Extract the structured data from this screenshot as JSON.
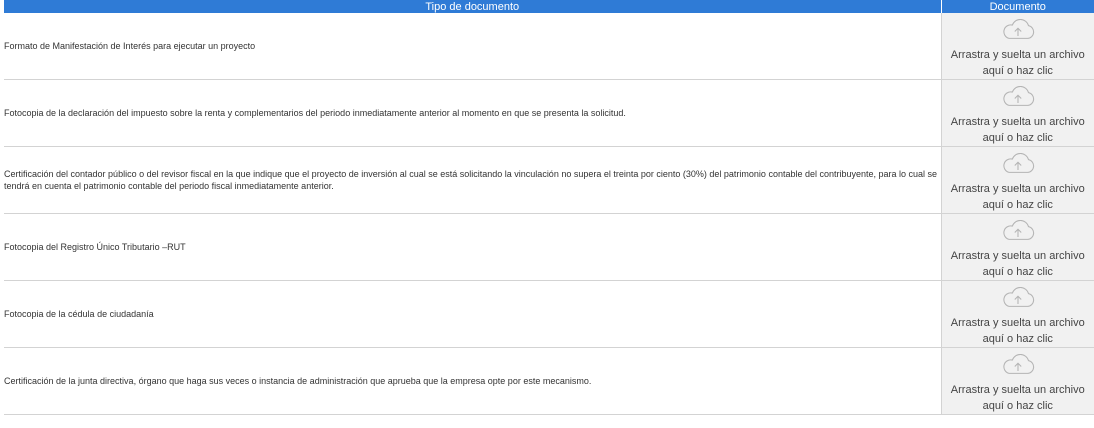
{
  "table": {
    "headers": {
      "type": "Tipo de documento",
      "document": "Documento"
    },
    "upload": {
      "line1": "Arrastra y suelta un archivo",
      "line2": "aquí o haz clic",
      "icon": "cloud-upload-icon"
    },
    "rows": [
      {
        "description": "Formato de Manifestación de Interés para ejecutar un proyecto"
      },
      {
        "description": "Fotocopia de la declaración del impuesto sobre la renta y complementarios del periodo inmediatamente anterior al momento en que se presenta la solicitud."
      },
      {
        "description": "Certificación del contador público o del revisor fiscal en la que indique que el proyecto de inversión al cual se está solicitando la vinculación no supera el treinta por ciento (30%) del patrimonio contable del contribuyente, para lo cual se tendrá en cuenta el patrimonio contable del periodo fiscal inmediatamente anterior."
      },
      {
        "description": "Fotocopia del Registro Único Tributario –RUT"
      },
      {
        "description": "Fotocopia de la cédula de ciudadanía"
      },
      {
        "description": "Certificación de la junta directiva, órgano que haga sus veces o instancia de administración que aprueba que la empresa opte por este mecanismo."
      }
    ]
  },
  "colors": {
    "header": "#2f7bd6",
    "upload_bg": "#f1f1f1"
  }
}
